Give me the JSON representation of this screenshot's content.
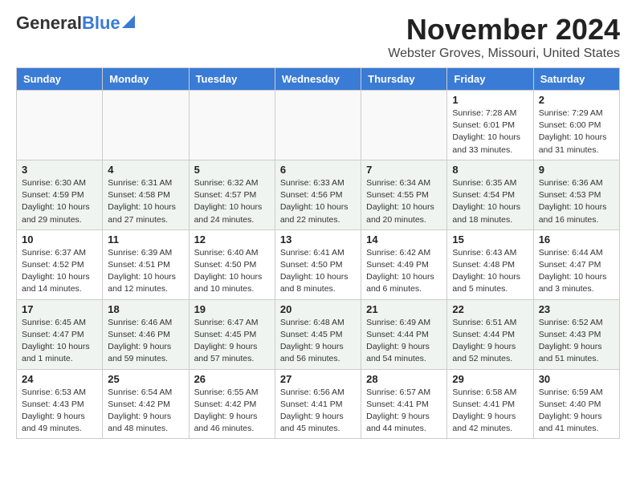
{
  "header": {
    "logo_general": "General",
    "logo_blue": "Blue",
    "month": "November 2024",
    "location": "Webster Groves, Missouri, United States"
  },
  "days_of_week": [
    "Sunday",
    "Monday",
    "Tuesday",
    "Wednesday",
    "Thursday",
    "Friday",
    "Saturday"
  ],
  "weeks": [
    [
      {
        "day": "",
        "info": ""
      },
      {
        "day": "",
        "info": ""
      },
      {
        "day": "",
        "info": ""
      },
      {
        "day": "",
        "info": ""
      },
      {
        "day": "",
        "info": ""
      },
      {
        "day": "1",
        "info": "Sunrise: 7:28 AM\nSunset: 6:01 PM\nDaylight: 10 hours\nand 33 minutes."
      },
      {
        "day": "2",
        "info": "Sunrise: 7:29 AM\nSunset: 6:00 PM\nDaylight: 10 hours\nand 31 minutes."
      }
    ],
    [
      {
        "day": "3",
        "info": "Sunrise: 6:30 AM\nSunset: 4:59 PM\nDaylight: 10 hours\nand 29 minutes."
      },
      {
        "day": "4",
        "info": "Sunrise: 6:31 AM\nSunset: 4:58 PM\nDaylight: 10 hours\nand 27 minutes."
      },
      {
        "day": "5",
        "info": "Sunrise: 6:32 AM\nSunset: 4:57 PM\nDaylight: 10 hours\nand 24 minutes."
      },
      {
        "day": "6",
        "info": "Sunrise: 6:33 AM\nSunset: 4:56 PM\nDaylight: 10 hours\nand 22 minutes."
      },
      {
        "day": "7",
        "info": "Sunrise: 6:34 AM\nSunset: 4:55 PM\nDaylight: 10 hours\nand 20 minutes."
      },
      {
        "day": "8",
        "info": "Sunrise: 6:35 AM\nSunset: 4:54 PM\nDaylight: 10 hours\nand 18 minutes."
      },
      {
        "day": "9",
        "info": "Sunrise: 6:36 AM\nSunset: 4:53 PM\nDaylight: 10 hours\nand 16 minutes."
      }
    ],
    [
      {
        "day": "10",
        "info": "Sunrise: 6:37 AM\nSunset: 4:52 PM\nDaylight: 10 hours\nand 14 minutes."
      },
      {
        "day": "11",
        "info": "Sunrise: 6:39 AM\nSunset: 4:51 PM\nDaylight: 10 hours\nand 12 minutes."
      },
      {
        "day": "12",
        "info": "Sunrise: 6:40 AM\nSunset: 4:50 PM\nDaylight: 10 hours\nand 10 minutes."
      },
      {
        "day": "13",
        "info": "Sunrise: 6:41 AM\nSunset: 4:50 PM\nDaylight: 10 hours\nand 8 minutes."
      },
      {
        "day": "14",
        "info": "Sunrise: 6:42 AM\nSunset: 4:49 PM\nDaylight: 10 hours\nand 6 minutes."
      },
      {
        "day": "15",
        "info": "Sunrise: 6:43 AM\nSunset: 4:48 PM\nDaylight: 10 hours\nand 5 minutes."
      },
      {
        "day": "16",
        "info": "Sunrise: 6:44 AM\nSunset: 4:47 PM\nDaylight: 10 hours\nand 3 minutes."
      }
    ],
    [
      {
        "day": "17",
        "info": "Sunrise: 6:45 AM\nSunset: 4:47 PM\nDaylight: 10 hours\nand 1 minute."
      },
      {
        "day": "18",
        "info": "Sunrise: 6:46 AM\nSunset: 4:46 PM\nDaylight: 9 hours\nand 59 minutes."
      },
      {
        "day": "19",
        "info": "Sunrise: 6:47 AM\nSunset: 4:45 PM\nDaylight: 9 hours\nand 57 minutes."
      },
      {
        "day": "20",
        "info": "Sunrise: 6:48 AM\nSunset: 4:45 PM\nDaylight: 9 hours\nand 56 minutes."
      },
      {
        "day": "21",
        "info": "Sunrise: 6:49 AM\nSunset: 4:44 PM\nDaylight: 9 hours\nand 54 minutes."
      },
      {
        "day": "22",
        "info": "Sunrise: 6:51 AM\nSunset: 4:44 PM\nDaylight: 9 hours\nand 52 minutes."
      },
      {
        "day": "23",
        "info": "Sunrise: 6:52 AM\nSunset: 4:43 PM\nDaylight: 9 hours\nand 51 minutes."
      }
    ],
    [
      {
        "day": "24",
        "info": "Sunrise: 6:53 AM\nSunset: 4:43 PM\nDaylight: 9 hours\nand 49 minutes."
      },
      {
        "day": "25",
        "info": "Sunrise: 6:54 AM\nSunset: 4:42 PM\nDaylight: 9 hours\nand 48 minutes."
      },
      {
        "day": "26",
        "info": "Sunrise: 6:55 AM\nSunset: 4:42 PM\nDaylight: 9 hours\nand 46 minutes."
      },
      {
        "day": "27",
        "info": "Sunrise: 6:56 AM\nSunset: 4:41 PM\nDaylight: 9 hours\nand 45 minutes."
      },
      {
        "day": "28",
        "info": "Sunrise: 6:57 AM\nSunset: 4:41 PM\nDaylight: 9 hours\nand 44 minutes."
      },
      {
        "day": "29",
        "info": "Sunrise: 6:58 AM\nSunset: 4:41 PM\nDaylight: 9 hours\nand 42 minutes."
      },
      {
        "day": "30",
        "info": "Sunrise: 6:59 AM\nSunset: 4:40 PM\nDaylight: 9 hours\nand 41 minutes."
      }
    ]
  ]
}
